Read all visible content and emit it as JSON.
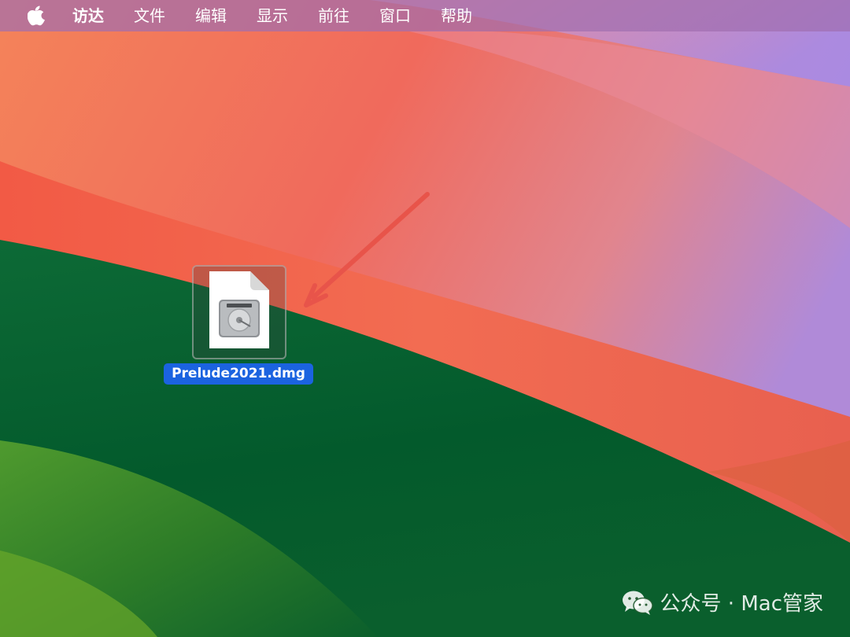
{
  "menubar": {
    "apple_icon": "apple-logo-icon",
    "app_name": "访达",
    "items": [
      "文件",
      "编辑",
      "显示",
      "前往",
      "窗口",
      "帮助"
    ]
  },
  "desktop": {
    "file": {
      "name": "Prelude2021.dmg",
      "icon": "disk-image-icon",
      "selected": true
    },
    "annotation": {
      "type": "arrow",
      "color": "#e8544a"
    }
  },
  "watermark": {
    "icon": "wechat-icon",
    "text": "公众号 · Mac管家"
  },
  "colors": {
    "selection": "#1b63e0",
    "menubar": "#a06eaf"
  }
}
